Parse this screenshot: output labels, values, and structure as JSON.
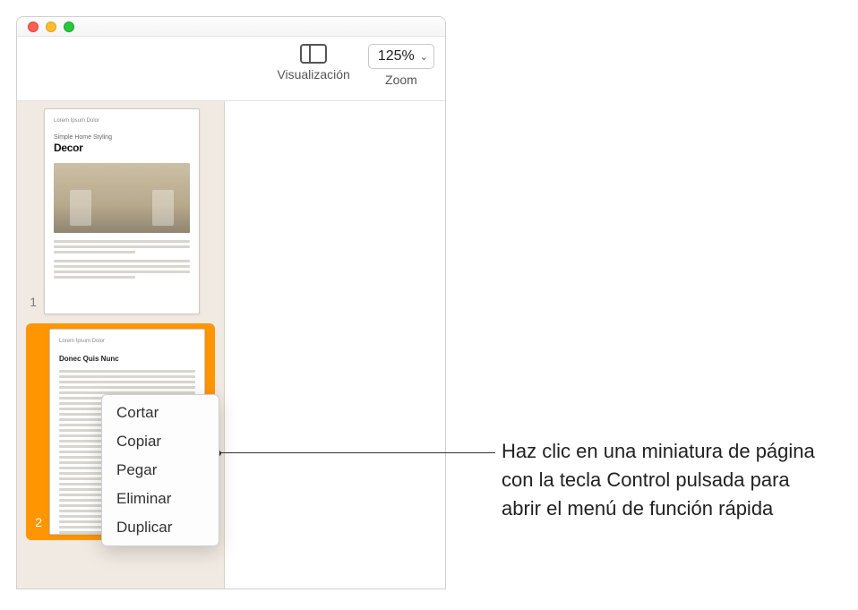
{
  "traffic": {
    "close": "close",
    "minimize": "minimize",
    "maximize": "maximize"
  },
  "toolbar": {
    "view_label": "Visualización",
    "zoom_value": "125%",
    "zoom_label": "Zoom"
  },
  "sidebar": {
    "thumbs": [
      {
        "num": "1",
        "kicker": "Lorem Ipsum Dolor",
        "subtitle": "Simple Home Styling",
        "title": "Decor"
      },
      {
        "num": "2",
        "kicker": "Lorem Ipsum Dolor",
        "heading": "Donec Quis Nunc"
      }
    ]
  },
  "context_menu": {
    "items": [
      "Cortar",
      "Copiar",
      "Pegar",
      "Eliminar",
      "Duplicar"
    ]
  },
  "callout": {
    "text": "Haz clic en una miniatura de página con la tecla Control pulsada para abrir el menú de función rápida"
  }
}
